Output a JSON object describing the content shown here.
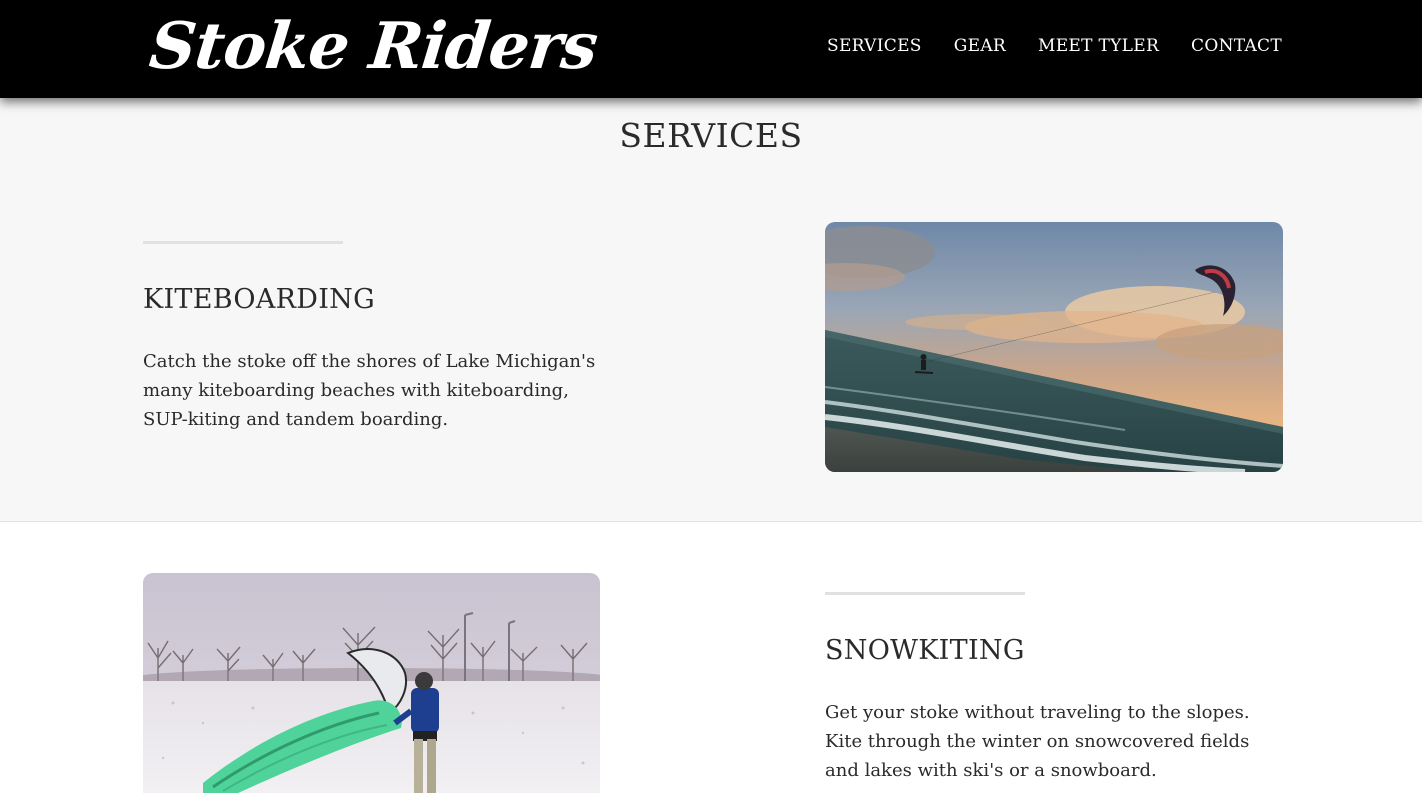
{
  "header": {
    "logo": "Stoke Riders",
    "nav": [
      "SERVICES",
      "GEAR",
      "MEET TYLER",
      "CONTACT"
    ]
  },
  "page": {
    "title": "SERVICES"
  },
  "services": [
    {
      "title": "KITEBOARDING",
      "text": "Catch the stoke off the shores of Lake Michigan's many kiteboarding beaches with kiteboarding, SUP-kiting and tandem boarding."
    },
    {
      "title": "SNOWKITING",
      "text": "Get your stoke without traveling to the slopes. Kite through the winter on snowcovered fields and lakes with ski's or a snowboard."
    }
  ],
  "colors": {
    "header_bg": "#000000",
    "section_grey": "#f7f7f7",
    "text": "#2a2a2a",
    "rule": "#e1e1e1"
  }
}
